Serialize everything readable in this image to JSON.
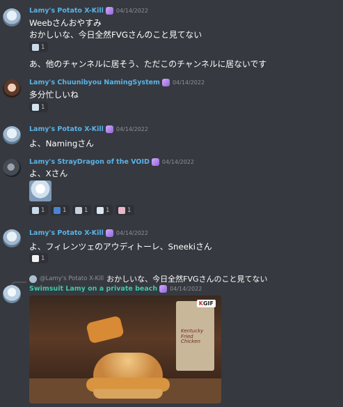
{
  "colors": {
    "background": "#36393f",
    "username_blue": "#59b3e8",
    "username_green": "#3fc9a9",
    "text": "#ffffff",
    "meta": "#8e9297"
  },
  "messages": [
    {
      "author": "Lamy's Potato X-Kill",
      "date": "04/14/2022",
      "lines": [
        "Weebさんおやすみ",
        "おかしいな、今日全然FVGさんのこと見てない"
      ],
      "reactions": [
        {
          "emoji": "sticker-icon",
          "count": "1"
        }
      ],
      "after_reaction_line": "あ、他のチャンネルに居そう、ただこのチャンネルに居ないです"
    },
    {
      "author": "Lamy's Chuunibyou NamingSystem",
      "date": "04/14/2022",
      "lines": [
        "多分忙しいね"
      ],
      "reactions": [
        {
          "emoji": "sticker-icon",
          "count": "1"
        }
      ]
    },
    {
      "author": "Lamy's Potato X-Kill",
      "date": "04/14/2022",
      "lines": [
        "よ、Namingさん"
      ]
    },
    {
      "author": "Lamy's StrayDragon of the VOID",
      "date": "04/14/2022",
      "lines": [
        "よ、Xさん"
      ],
      "reactions": [
        {
          "emoji": "sticker-icon",
          "count": "1"
        },
        {
          "emoji": "sticker-icon",
          "count": "1"
        },
        {
          "emoji": "sticker-icon",
          "count": "1"
        },
        {
          "emoji": "sticker-icon",
          "count": "1"
        },
        {
          "emoji": "sticker-icon",
          "count": "1"
        }
      ]
    },
    {
      "author": "Lamy's Potato X-Kill",
      "date": "04/14/2022",
      "lines": [
        "よ、フィレンツェのアウディトーレ、Sneekiさん"
      ],
      "reactions": [
        {
          "emoji": "sticker-icon",
          "count": "1"
        }
      ]
    },
    {
      "reply_to_author": "@Lamy's Potato X-Kill",
      "reply_to_text": "おかしいな、今日全然FVGさんのこと見てない",
      "author": "Swimsuit Lamy on a private beach",
      "date": "04/14/2022",
      "gif_badge_k": "K",
      "gif_badge": "GIF",
      "gif_caption": "Kentucky Fried Chicken"
    }
  ]
}
